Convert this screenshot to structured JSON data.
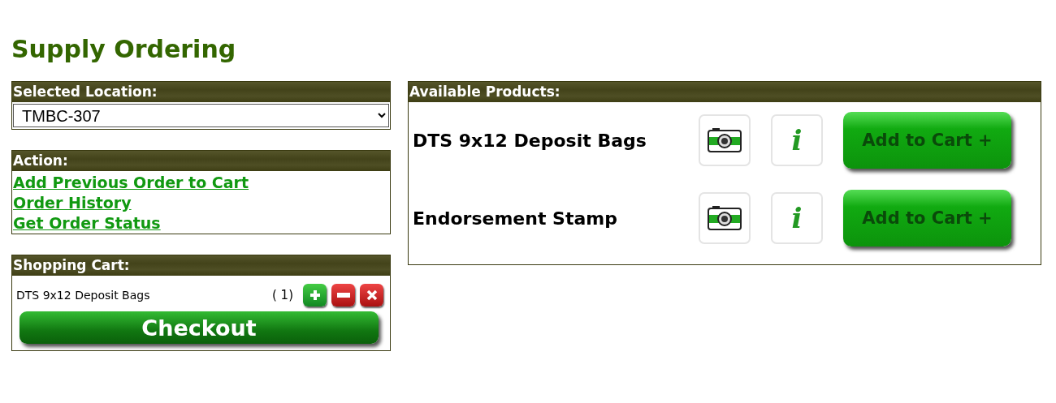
{
  "page_title": "Supply Ordering",
  "location": {
    "heading": "Selected Location:",
    "value": "TMBC-307"
  },
  "action": {
    "heading": "Action:",
    "links": [
      "Add Previous Order to Cart",
      "Order History",
      "Get Order Status"
    ]
  },
  "cart": {
    "heading": "Shopping Cart:",
    "items": [
      {
        "name": "DTS 9x12 Deposit Bags",
        "quantity": "( 1)"
      }
    ],
    "checkout": "Checkout"
  },
  "products": {
    "heading": "Available Products:",
    "items": [
      {
        "name": "DTS 9x12 Deposit Bags",
        "info_glyph": "i",
        "add_label": "Add to Cart +"
      },
      {
        "name": "Endorsement Stamp",
        "info_glyph": "i",
        "add_label": "Add to Cart +"
      }
    ]
  }
}
